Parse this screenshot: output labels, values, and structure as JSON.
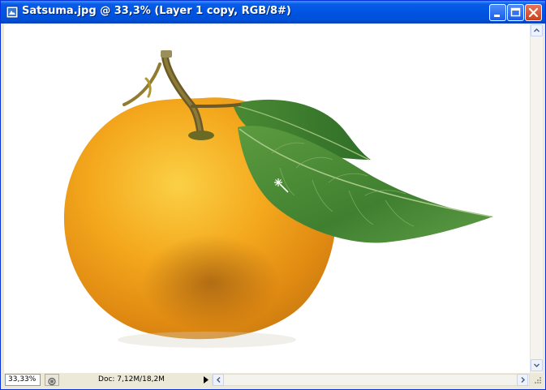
{
  "window": {
    "title": "Satsuma.jpg @ 33,3% (Layer 1 copy, RGB/8#)",
    "controls": [
      "minimize",
      "maximize",
      "close"
    ]
  },
  "canvas": {
    "content": "Satsuma orange with stem and leaves",
    "icons": {
      "document": "photoshop-document-icon",
      "cursor": "magic-wand-cursor-icon"
    }
  },
  "statusbar": {
    "zoom": "33,33%",
    "doc_info": "Doc: 7,12M/18,2M"
  },
  "colors": {
    "titlebar": "#0054e3",
    "close_button": "#d8532c",
    "chrome": "#ece9d8",
    "orange": "#f0a21c",
    "leaf": "#4b8a33"
  }
}
